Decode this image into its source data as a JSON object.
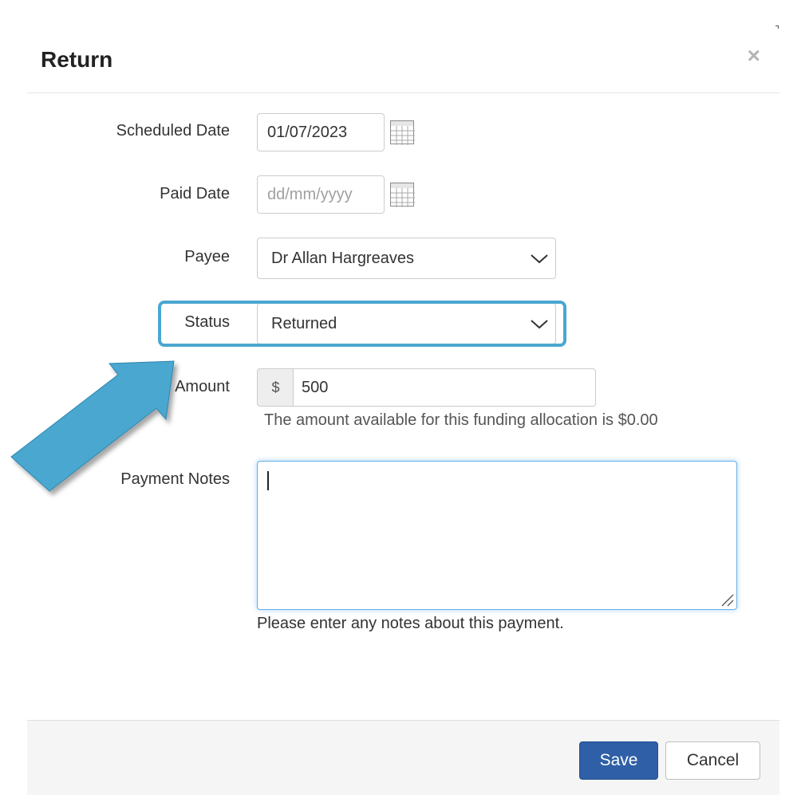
{
  "dialog": {
    "title": "Return",
    "close_label": "×"
  },
  "form": {
    "scheduled_date": {
      "label": "Scheduled Date",
      "value": "01/07/2023"
    },
    "paid_date": {
      "label": "Paid Date",
      "placeholder": "dd/mm/yyyy"
    },
    "payee": {
      "label": "Payee",
      "selected": "Dr Allan Hargreaves"
    },
    "status": {
      "label": "Status",
      "selected": "Returned"
    },
    "amount": {
      "label": "Amount",
      "currency_symbol": "$",
      "value": "500",
      "help": "The amount available for this funding allocation is $0.00"
    },
    "payment_notes": {
      "label": "Payment Notes",
      "value": "",
      "help": "Please enter any notes about this payment."
    }
  },
  "footer": {
    "save_label": "Save",
    "cancel_label": "Cancel"
  },
  "icons": {
    "calendar": "calendar-icon",
    "chevron": "chevron-down-icon",
    "annotation_arrow": "arrow-icon"
  },
  "colors": {
    "highlight": "#4aa7d0",
    "primary_button": "#2f5fa6",
    "focus_border": "#66afe9"
  }
}
